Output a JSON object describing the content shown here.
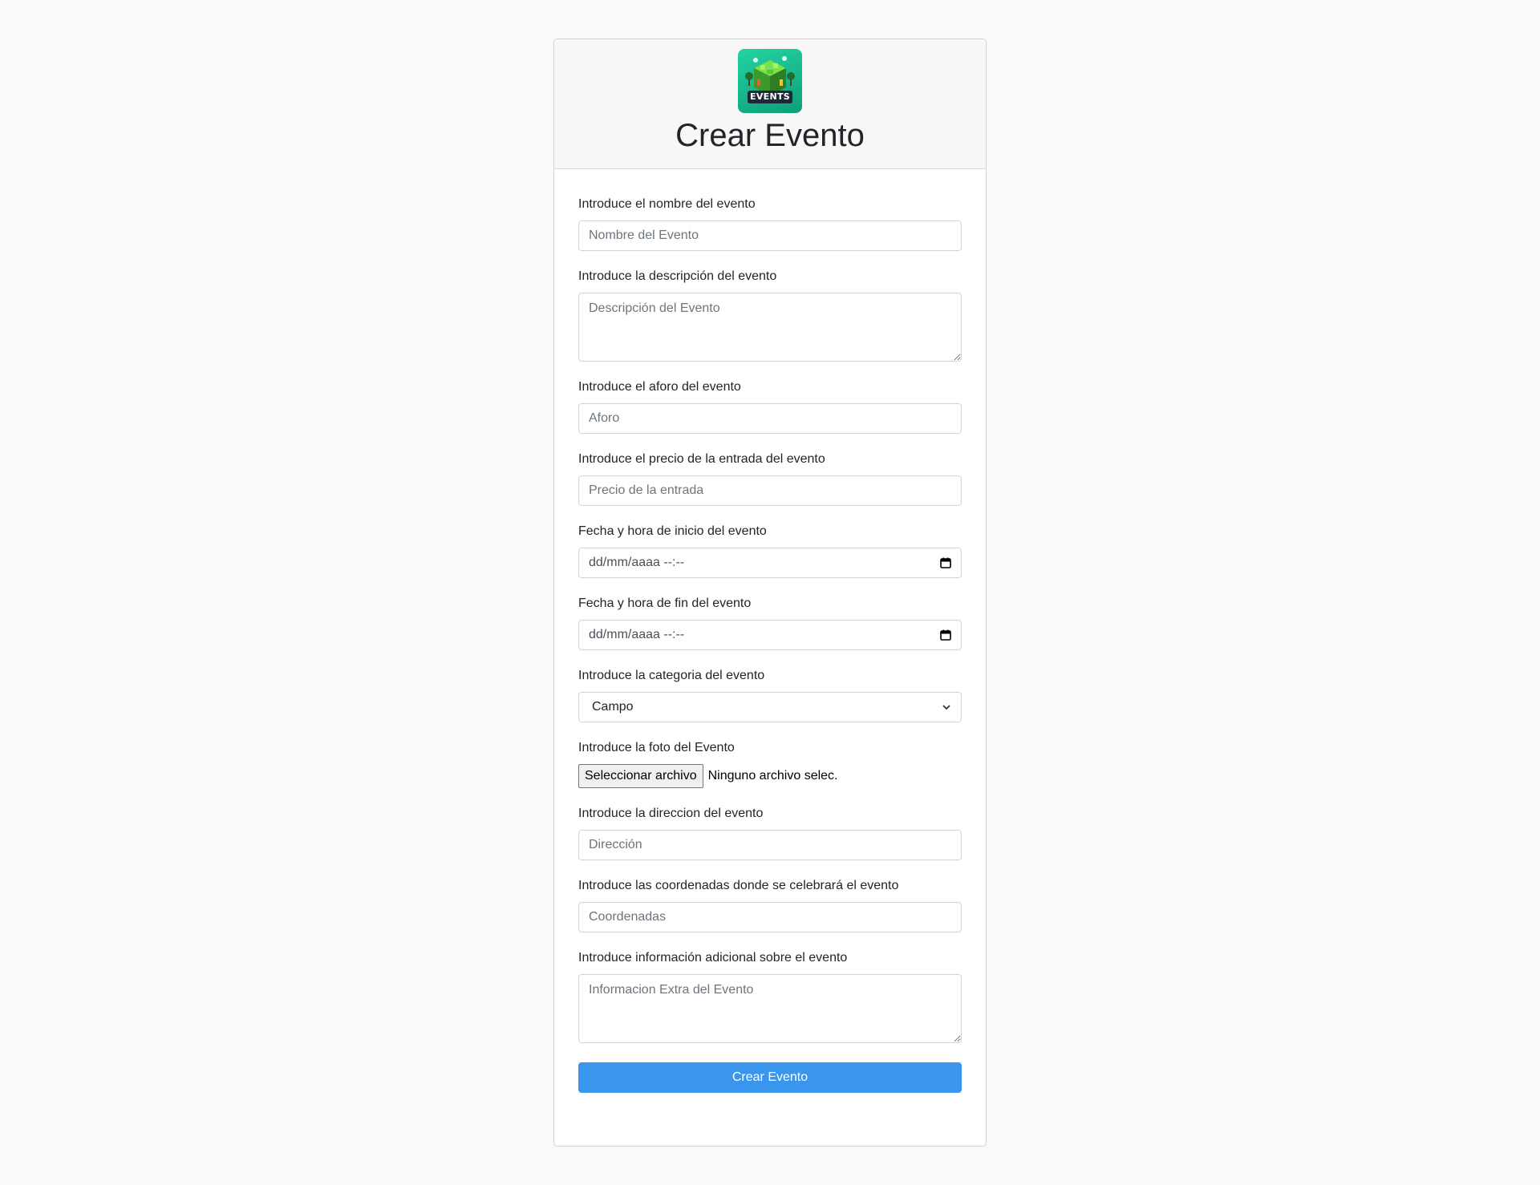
{
  "header": {
    "logo_text": "EVENTS",
    "title": "Crear Evento"
  },
  "form": {
    "name": {
      "label": "Introduce el nombre del evento",
      "placeholder": "Nombre del Evento",
      "value": ""
    },
    "description": {
      "label": "Introduce la descripción del evento",
      "placeholder": "Descripción del Evento",
      "value": ""
    },
    "capacity": {
      "label": "Introduce el aforo del evento",
      "placeholder": "Aforo",
      "value": ""
    },
    "price": {
      "label": "Introduce el precio de la entrada del evento",
      "placeholder": "Precio de la entrada",
      "value": ""
    },
    "start": {
      "label": "Fecha y hora de inicio del evento",
      "value": "dd/mm/aaaa --:--",
      "icon": "calendar-icon"
    },
    "end": {
      "label": "Fecha y hora de fin del evento",
      "value": "dd/mm/aaaa --:--",
      "icon": "calendar-icon"
    },
    "category": {
      "label": "Introduce la categoria del evento",
      "selected": "Campo",
      "icon": "chevron-down-icon"
    },
    "photo": {
      "label": "Introduce la foto del Evento",
      "button": "Seleccionar archivo",
      "status": "Ninguno archivo selec."
    },
    "address": {
      "label": "Introduce la direccion del evento",
      "placeholder": "Dirección",
      "value": ""
    },
    "coordinates": {
      "label": "Introduce las coordenadas donde se celebrará el evento",
      "placeholder": "Coordenadas",
      "value": ""
    },
    "extra": {
      "label": "Introduce información adicional sobre el evento",
      "placeholder": "Informacion Extra del Evento",
      "value": ""
    },
    "submit_label": "Crear Evento"
  },
  "colors": {
    "page_bg": "#f8f9fa",
    "primary_button": "#3a96ed",
    "logo_bg": "#14b88c"
  }
}
